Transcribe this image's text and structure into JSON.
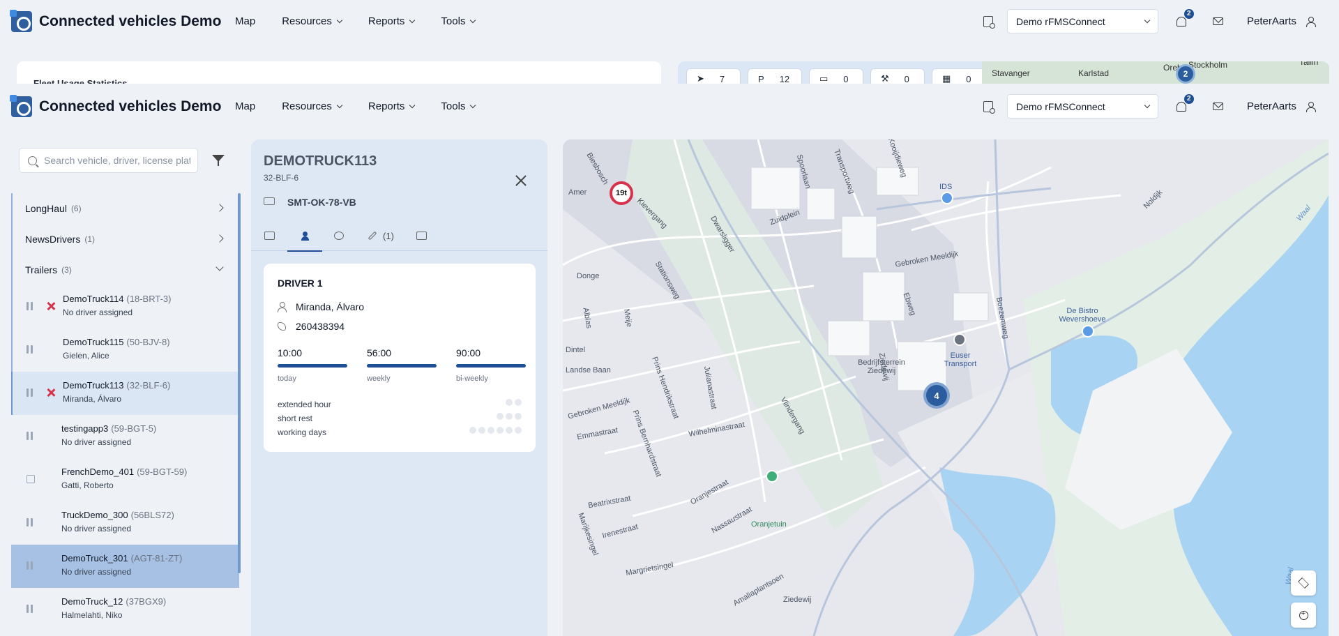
{
  "app": {
    "brand": "Connected vehicles Demo",
    "nav": [
      "Map",
      "Resources",
      "Reports",
      "Tools"
    ],
    "account_select": "Demo rFMSConnect",
    "notification_count": "2",
    "username": "PeterAarts"
  },
  "background": {
    "fleet_card_title": "Fleet Usage Statistics",
    "stats": [
      "7",
      "12",
      "0",
      "0",
      "0"
    ],
    "map_labels": [
      "Stavanger",
      "Karlstad",
      "Orebro",
      "Stockholm",
      "Tallin"
    ],
    "cluster": "2"
  },
  "sidebar": {
    "search_placeholder": "Search vehicle, driver, license plate",
    "groups": [
      {
        "name": "LongHaul",
        "count": "(6)"
      },
      {
        "name": "NewsDrivers",
        "count": "(1)"
      },
      {
        "name": "Trailers",
        "count": "(3)"
      }
    ],
    "vehicles": [
      {
        "name": "DemoTruck114",
        "plate": "(18-BRT-3)",
        "driver": "No driver assigned"
      },
      {
        "name": "DemoTruck115",
        "plate": "(50-BJV-8)",
        "driver": "Gielen, Alice"
      },
      {
        "name": "DemoTruck113",
        "plate": "(32-BLF-6)",
        "driver": "Miranda, Álvaro"
      },
      {
        "name": "testingapp3",
        "plate": "(59-BGT-5)",
        "driver": "No driver assigned"
      },
      {
        "name": "FrenchDemo_401",
        "plate": "(59-BGT-59)",
        "driver": "Gatti, Roberto"
      },
      {
        "name": "TruckDemo_300",
        "plate": "(56BLS72)",
        "driver": "No driver assigned"
      },
      {
        "name": "DemoTruck_301",
        "plate": "(AGT-81-ZT)",
        "driver": "No driver assigned"
      },
      {
        "name": "DemoTruck_12",
        "plate": "(37BGX9)",
        "driver": "Halmelahti, Niko"
      }
    ]
  },
  "detail": {
    "title": "DEMOTRUCK113",
    "plate": "32-BLF-6",
    "trailer_plate": "SMT-OK-78-VB",
    "wrench_count": "(1)",
    "driver_card": {
      "title": "DRIVER 1",
      "name": "Miranda, Álvaro",
      "phone": "260438394",
      "hours": [
        {
          "value": "10:00",
          "label": "today"
        },
        {
          "value": "56:00",
          "label": "weekly"
        },
        {
          "value": "90:00",
          "label": "bi-weekly"
        }
      ],
      "rest_items": [
        "extended hour",
        "short rest",
        "working days"
      ]
    }
  },
  "map": {
    "weight_sign": "19t",
    "cluster": "4",
    "streets": [
      "Dwarsligger",
      "Transportweg",
      "Kooijdieweg",
      "Spoorlaan",
      "Zuidplein",
      "Gebroken Meeldijk",
      "Stationsweg",
      "Vlindergang",
      "Ebweg",
      "Ziedewij",
      "Boezemweg",
      "Noldijk",
      "Donge",
      "Alblas",
      "Meije",
      "Dintel",
      "Emmastraat",
      "Wilhelminastraat",
      "Julianastraat",
      "Prins Hendrikstraat",
      "Prins Bernhardstraat",
      "Beatrixstraat",
      "Irenestraat",
      "Margrietsingel",
      "Oranjestraat",
      "Nassaustraat",
      "Amaliaplantsoen",
      "Marijkesingel",
      "Amer",
      "Biesbosch",
      "Kievergang",
      "Landse Baan",
      "Gebroken Meeldijk"
    ],
    "water_labels": [
      "Waal",
      "Waal"
    ],
    "pois": [
      "IDS",
      "De Bistro Wevershoeve",
      "Euser Transport",
      "Bedrijfsterrein Ziedewij",
      "Oranjetuin",
      "Ziedewij"
    ]
  }
}
